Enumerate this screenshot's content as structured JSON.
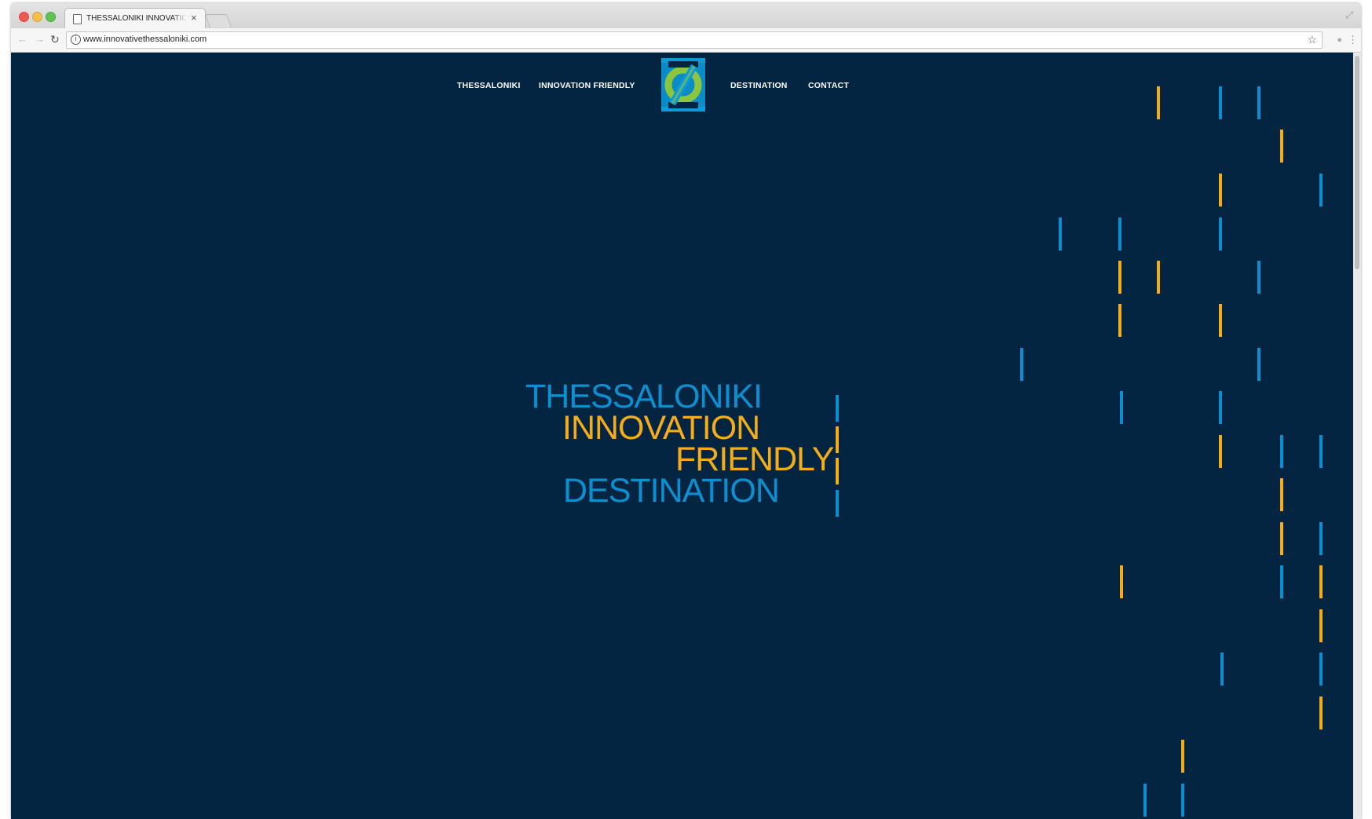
{
  "browser": {
    "tab_title": "THESSALONIKI INNOVATION FRIENDLY DESTINATION",
    "tab_close": "×",
    "url": "www.innovativethessaloniki.com",
    "icons": [
      "back-icon",
      "forward-icon",
      "reload-icon",
      "info-icon",
      "star-icon",
      "extension-icon",
      "menu-icon",
      "fullscreen-icon"
    ]
  },
  "nav": {
    "items": [
      "THESSALONIKI",
      "INNOVATION FRIENDLY",
      "DESTINATION",
      "CONTACT"
    ]
  },
  "hero": {
    "lines": [
      "THESSALONIKI",
      "INNOVATION",
      "FRIENDLY",
      "DESTINATION"
    ]
  },
  "colors": {
    "background": "#032541",
    "blue": "#0b8fd0",
    "yellow": "#f5ac1b",
    "logo_green": "#8cc63f"
  }
}
